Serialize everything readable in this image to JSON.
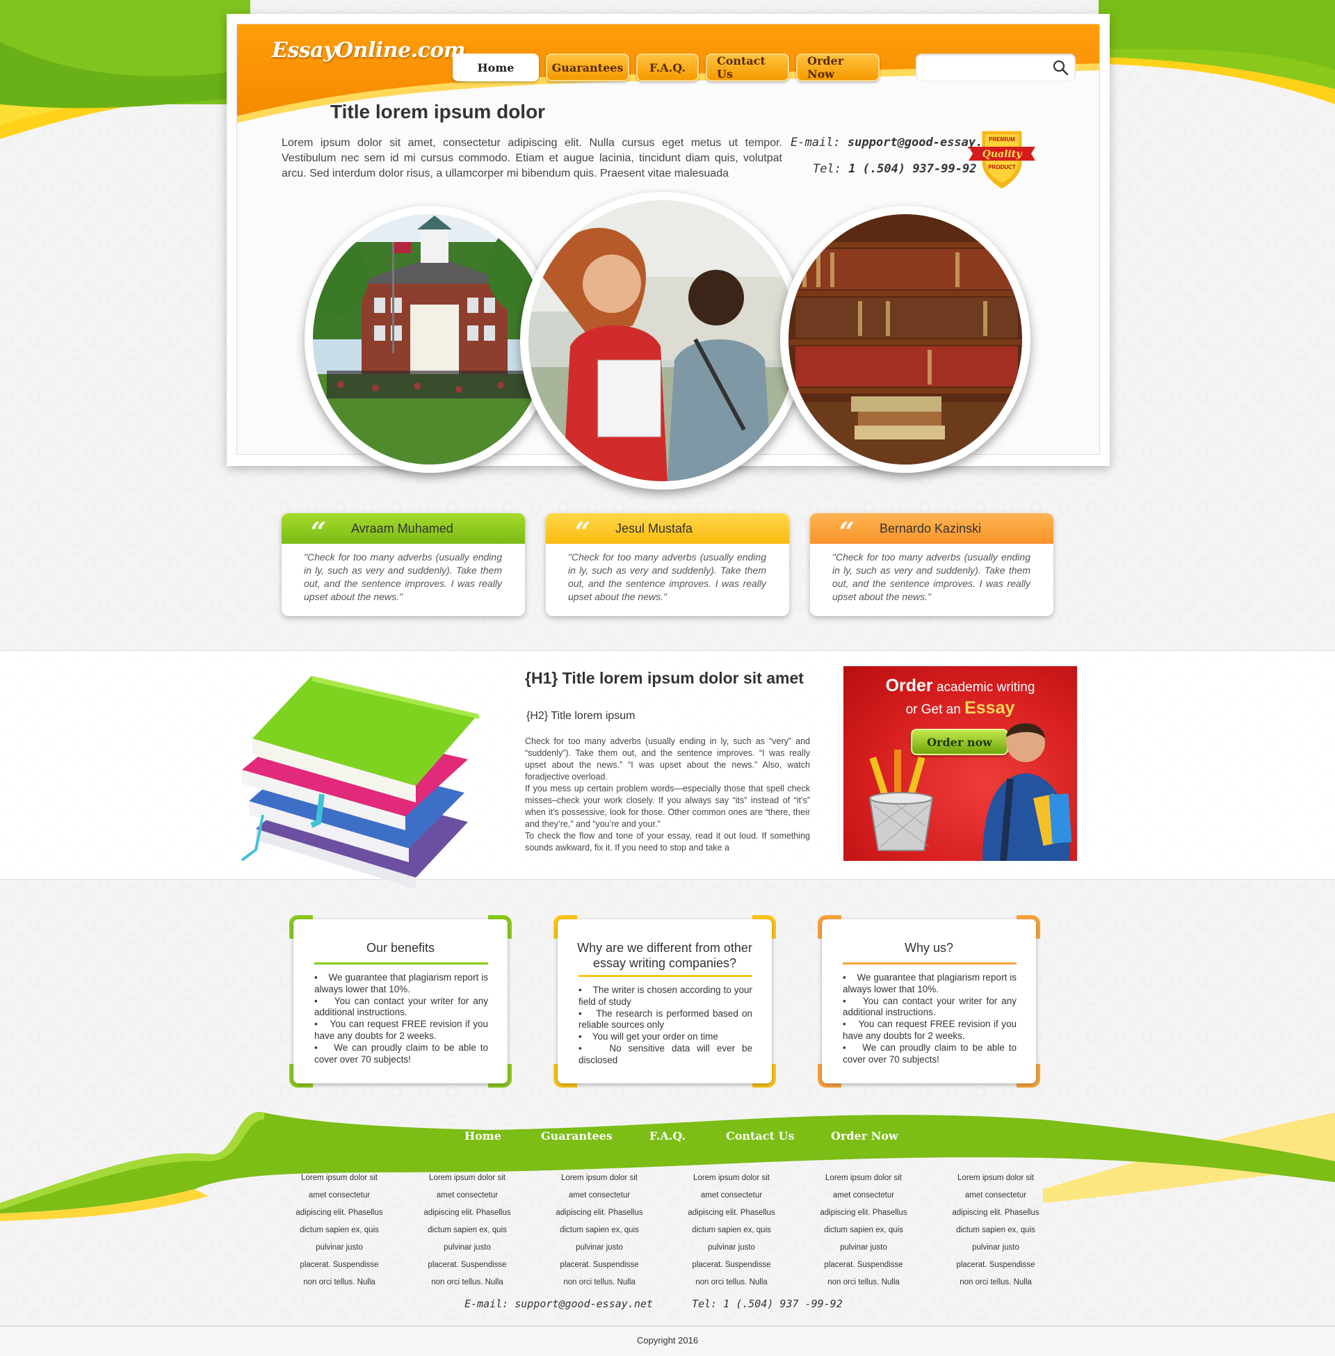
{
  "logo": {
    "text": "EssayOnline.com"
  },
  "nav": [
    {
      "label": "Home",
      "active": true
    },
    {
      "label": "Guarantees",
      "active": false
    },
    {
      "label": "F.A.Q.",
      "active": false
    },
    {
      "label": "Contact Us",
      "active": false
    },
    {
      "label": "Order Now",
      "active": false
    }
  ],
  "search": {
    "value": "",
    "placeholder": ""
  },
  "hero": {
    "title": "Title lorem ipsum dolor",
    "intro": "Lorem ipsum dolor sit amet, consectetur adipiscing elit. Nulla cursus eget metus ut tempor. Vestibulum nec sem id mi cursus commodo. Etiam et augue lacinia, tincidunt diam quis, volutpat arcu. Sed interdum dolor risus, a ullamcorper mi bibendum quis. Praesent vitae malesuada",
    "email_label": "E-mail:",
    "email": "support@good-essay.net",
    "tel_label": "Tel:",
    "tel": "1 (.504) 937-99-92",
    "badge": {
      "top": "PREMIUM",
      "middle": "Quality",
      "bottom": "PRODUCT"
    }
  },
  "testimonials": [
    {
      "name": "Avraam Muhamed",
      "text": "\"Check for too many adverbs (usually ending in ly, such as very and suddenly). Take them out, and the sentence improves. I was really upset about the news.\"",
      "color": "#8bc81c"
    },
    {
      "name": "Jesul Mustafa",
      "text": "\"Check for too many adverbs (usually ending in ly, such as very and suddenly). Take them out, and the sentence improves. I was really upset about the news.\"",
      "color": "#fbc417"
    },
    {
      "name": "Bernardo Kazinski",
      "text": "\"Check for too many adverbs (usually ending in ly, such as very and suddenly). Take them out, and the sentence improves. I was really upset about the news.\"",
      "color": "#f8a23a"
    }
  ],
  "article": {
    "h1": "{H1} Title lorem ipsum dolor sit amet",
    "h2": "{H2} Title lorem ipsum",
    "paragraphs": [
      "Check for too many adverbs (usually ending in ly, such as “very” and “suddenly”). Take them out, and the sentence improves. “I was really upset about the news.” “I was upset about the news.” Also, watch foradjective overload.",
      "If you mess up certain problem words—especially those that spell check misses–check your work closely. If you always say “its” instead of “it’s” when it’s possessive, look for those.  Other common ones are “there, their and they’re,” and “you’re and your.”",
      "To check the flow and tone of your essay, read it out loud. If something sounds awkward, fix it. If you need to stop and take a"
    ]
  },
  "order_box": {
    "line1_bold": "Order",
    "line1_rest": "academic writing",
    "line2_rest": "or Get an",
    "line2_bold": "Essay",
    "button": "Order now"
  },
  "info_boxes": [
    {
      "title": "Our benefits",
      "color": "#8bc81c",
      "items": [
        "We guarantee that plagiarism report is always lower that 10%.",
        "You can contact your writer for any additional instructions.",
        "You can request FREE revision if you have any doubts for 2 weeks.",
        "We can proudly claim to be able to cover over 70 subjects!"
      ]
    },
    {
      "title": "Why are we different from other essay writing companies?",
      "color": "#fbc417",
      "items": [
        "The writer is chosen according to your field of study",
        "The research is performed based on reliable sources only",
        "You will get your order on time",
        "No sensitive data will ever be disclosed"
      ]
    },
    {
      "title": "Why us?",
      "color": "#f8a23a",
      "items": [
        "We guarantee that plagiarism report is always lower that 10%.",
        "You can contact your writer for any additional instructions.",
        "You can request FREE revision if you have any doubts for 2 weeks.",
        "We can proudly claim to be able to cover over 70 subjects!"
      ]
    }
  ],
  "footer": {
    "nav": [
      "Home",
      "Guarantees",
      "F.A.Q.",
      "Contact Us",
      "Order Now"
    ],
    "columns": [
      [
        "Lorem ipsum dolor sit",
        "amet consectetur",
        "adipiscing elit. Phasellus",
        "dictum sapien ex, quis",
        "pulvinar justo",
        "placerat. Suspendisse",
        "non orci tellus. Nulla"
      ],
      [
        "Lorem ipsum dolor sit",
        "amet consectetur",
        "adipiscing elit. Phasellus",
        "dictum sapien ex, quis",
        "pulvinar justo",
        "placerat. Suspendisse",
        "non orci tellus. Nulla"
      ],
      [
        "Lorem ipsum dolor sit",
        "amet consectetur",
        "adipiscing elit. Phasellus",
        "dictum sapien ex, quis",
        "pulvinar justo",
        "placerat. Suspendisse",
        "non orci tellus. Nulla"
      ],
      [
        "Lorem ipsum dolor sit",
        "amet consectetur",
        "adipiscing elit. Phasellus",
        "dictum sapien ex, quis",
        "pulvinar justo",
        "placerat. Suspendisse",
        "non orci tellus. Nulla"
      ],
      [
        "Lorem ipsum dolor sit",
        "amet consectetur",
        "adipiscing elit. Phasellus",
        "dictum sapien ex, quis",
        "pulvinar justo",
        "placerat. Suspendisse",
        "non orci tellus. Nulla"
      ],
      [
        "Lorem ipsum dolor sit",
        "amet consectetur",
        "adipiscing elit. Phasellus",
        "dictum sapien ex, quis",
        "pulvinar justo",
        "placerat. Suspendisse",
        "non orci tellus. Nulla"
      ]
    ],
    "email": "E-mail: support@good-essay.net",
    "tel": "Tel: 1 (.504) 937 -99-92",
    "copyright": "Copyright 2016"
  },
  "colors": {
    "green": "#8bc81c",
    "yellow": "#fbc417",
    "orange": "#f8a23a",
    "red": "#d71f1f"
  },
  "icons": {
    "search": "search-icon",
    "quote": "quote-icon"
  }
}
